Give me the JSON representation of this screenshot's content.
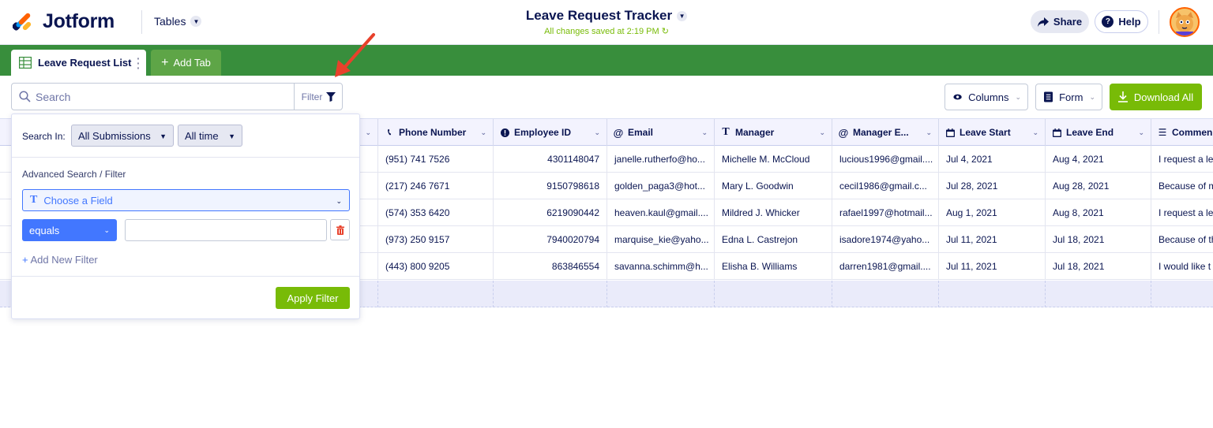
{
  "header": {
    "logo_text": "Jotform",
    "product_menu": "Tables",
    "doc_title": "Leave Request Tracker",
    "saved_status": "All changes saved at 2:19 PM",
    "share_label": "Share",
    "help_label": "Help"
  },
  "tabs": {
    "active_label": "Leave Request List",
    "add_label": "Add Tab"
  },
  "toolbar": {
    "search_placeholder": "Search",
    "filter_label": "Filter",
    "columns_label": "Columns",
    "form_label": "Form",
    "download_label": "Download All"
  },
  "colors": {
    "tab_bar": "#388e3c",
    "accent_green": "#78bb07",
    "accent_blue": "#4277ff",
    "navy_text": "#0a1551",
    "annotation_arrow": "#e8412b"
  },
  "filter_panel": {
    "search_in_label": "Search In:",
    "scope_value": "All Submissions",
    "time_value": "All time",
    "advanced_label": "Advanced Search / Filter",
    "field_placeholder": "Choose a Field",
    "operator_value": "equals",
    "add_filter_label": "Add New Filter",
    "apply_label": "Apply Filter"
  },
  "table": {
    "columns": [
      {
        "label": "",
        "icon": "chevron-down-icon"
      },
      {
        "label": "Phone Number",
        "icon": "phone-icon"
      },
      {
        "label": "Employee ID",
        "icon": "info-icon"
      },
      {
        "label": "Email",
        "icon": "at-icon"
      },
      {
        "label": "Manager",
        "icon": "text-icon"
      },
      {
        "label": "Manager E...",
        "icon": "at-icon"
      },
      {
        "label": "Leave Start",
        "icon": "calendar-icon"
      },
      {
        "label": "Leave End",
        "icon": "calendar-icon"
      },
      {
        "label": "Commen",
        "icon": "paragraph-icon"
      }
    ],
    "rows": [
      {
        "phone": "(951) 741 7526",
        "employee_id": "4301148047",
        "email": "janelle.rutherfo@ho...",
        "manager": "Michelle M. McCloud",
        "manager_email": "lucious1996@gmail....",
        "leave_start": "Jul 4, 2021",
        "leave_end": "Aug 4, 2021",
        "comment": "I request a le"
      },
      {
        "phone": "(217) 246 7671",
        "employee_id": "9150798618",
        "email": "golden_paga3@hot...",
        "manager": "Mary L. Goodwin",
        "manager_email": "cecil1986@gmail.c...",
        "leave_start": "Jul 28, 2021",
        "leave_end": "Aug 28, 2021",
        "comment": "Because of m"
      },
      {
        "phone": "(574) 353 6420",
        "employee_id": "6219090442",
        "email": "heaven.kaul@gmail....",
        "manager": "Mildred J. Whicker",
        "manager_email": "rafael1997@hotmail...",
        "leave_start": "Aug 1, 2021",
        "leave_end": "Aug 8, 2021",
        "comment": "I request a le"
      },
      {
        "phone": "(973) 250 9157",
        "employee_id": "7940020794",
        "email": "marquise_kie@yaho...",
        "manager": "Edna L. Castrejon",
        "manager_email": "isadore1974@yaho...",
        "leave_start": "Jul 11, 2021",
        "leave_end": "Jul 18, 2021",
        "comment": "Because of th"
      },
      {
        "phone": "(443) 800 9205",
        "employee_id": "863846554",
        "email": "savanna.schimm@h...",
        "manager": "Elisha B. Williams",
        "manager_email": "darren1981@gmail....",
        "leave_start": "Jul 11, 2021",
        "leave_end": "Jul 18, 2021",
        "comment": "I would like t"
      }
    ]
  }
}
